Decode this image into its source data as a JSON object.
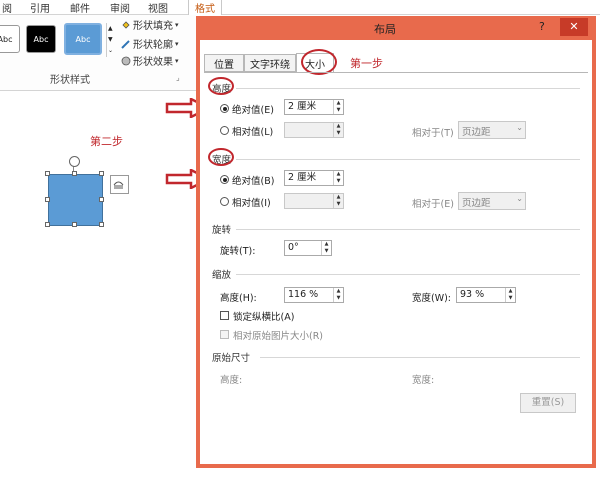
{
  "ribbon": {
    "tabs": [
      "阅",
      "引用",
      "邮件",
      "审阅",
      "视图",
      "格式"
    ],
    "style_buttons": [
      "Abc",
      "Abc",
      "Abc"
    ],
    "commands": {
      "fill": "形状填充",
      "outline": "形状轮廓",
      "effects": "形状效果"
    },
    "group_label": "形状样式"
  },
  "annotations": {
    "step1": "第一步",
    "step2": "第二步"
  },
  "dialog": {
    "title": "布局",
    "help": "?",
    "close": "✕",
    "tabs": [
      "位置",
      "文字环绕",
      "大小"
    ],
    "height_section": {
      "title": "高度",
      "absolute_label": "绝对值(E)",
      "absolute_value": "2 厘米",
      "relative_label": "相对值(L)",
      "relative_value": "",
      "relative_to_label": "相对于(T)",
      "relative_to_value": "页边距"
    },
    "width_section": {
      "title": "宽度",
      "absolute_label": "绝对值(B)",
      "absolute_value": "2 厘米",
      "relative_label": "相对值(I)",
      "relative_value": "",
      "relative_to_label": "相对于(E)",
      "relative_to_value": "页边距"
    },
    "rotate_section": {
      "title": "旋转",
      "rotate_label": "旋转(T):",
      "rotate_value": "0°"
    },
    "scale_section": {
      "title": "缩放",
      "height_label": "高度(H):",
      "height_value": "116 %",
      "width_label": "宽度(W):",
      "width_value": "93 %",
      "lock_aspect": "锁定纵横比(A)",
      "relative_original": "相对原始图片大小(R)"
    },
    "original_section": {
      "title": "原始尺寸",
      "height_label": "高度:",
      "width_label": "宽度:"
    },
    "reset_button": "重置(S)"
  },
  "colors": {
    "dialog_border": "#e86a4c",
    "annotation_red": "#c1272d",
    "shape_fill": "#5b9bd5",
    "accent_tab": "#c55a11"
  }
}
